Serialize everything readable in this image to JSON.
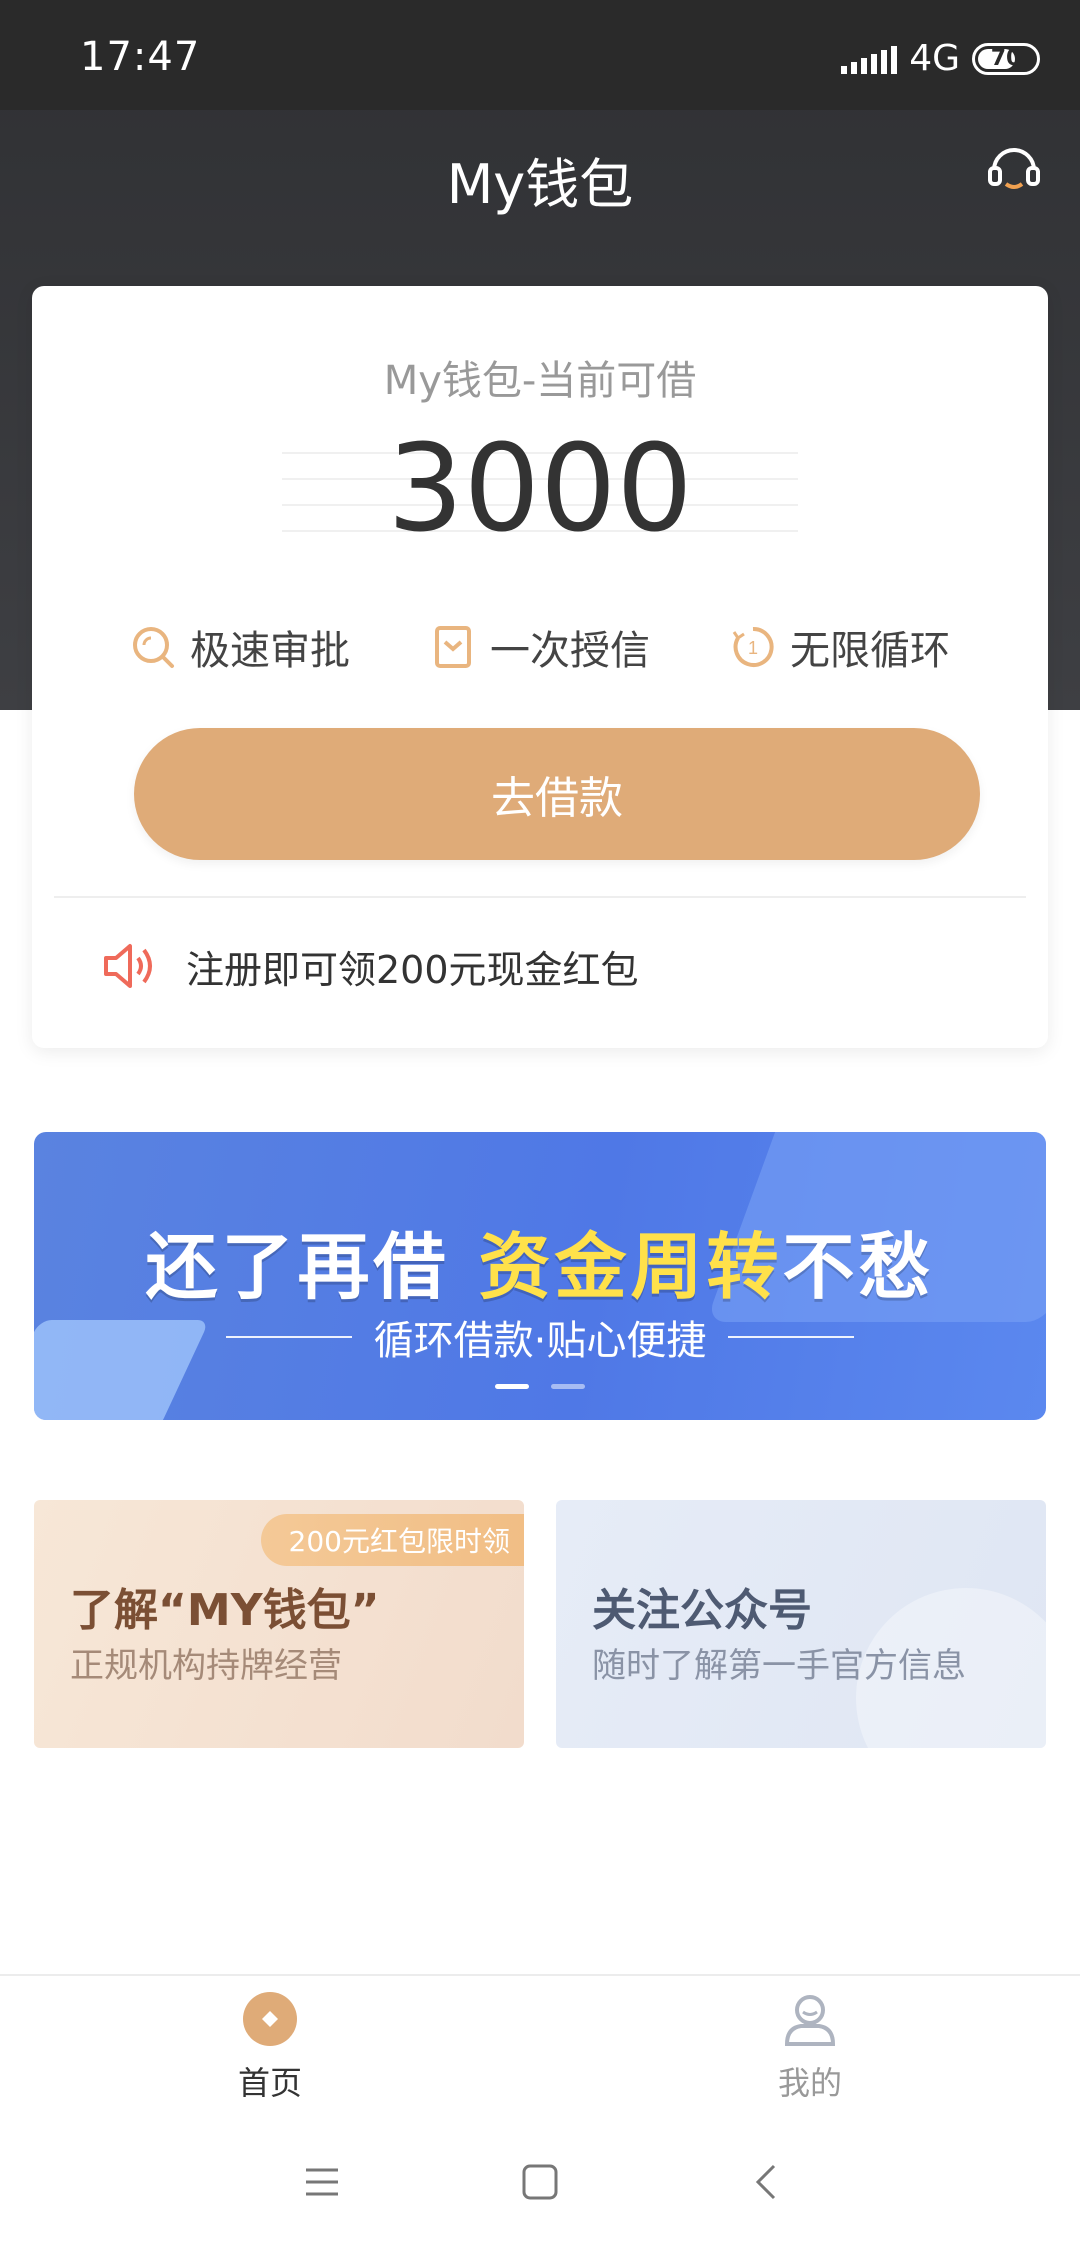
{
  "status_bar": {
    "time": "17:47",
    "network": "4G",
    "battery": "70",
    "battery_level": 0.7
  },
  "header": {
    "title": "My钱包",
    "service_icon": "headset-icon"
  },
  "card": {
    "subtitle": "My钱包-当前可借",
    "amount": "3000",
    "features": [
      {
        "label": "极速审批",
        "icon": "search-clock-icon"
      },
      {
        "label": "一次授信",
        "icon": "bookmark-icon"
      },
      {
        "label": "无限循环",
        "icon": "cycle-icon"
      }
    ],
    "borrow_button": "去借款",
    "promo": {
      "text": "注册即可领200元现金红包",
      "icon": "speaker-icon"
    }
  },
  "banner": {
    "title_part1": "还了再借",
    "title_highlight": "资金周转",
    "title_part2": "不愁",
    "subtitle": "循环借款·贴心便捷",
    "slides": 2,
    "active_slide": 1
  },
  "info_cards": [
    {
      "title": "了解“MY钱包”",
      "desc": "正规机构持牌经营",
      "ribbon": "200元红包限时领"
    },
    {
      "title": "关注公众号",
      "desc": "随时了解第一手官方信息"
    }
  ],
  "bottom_nav": [
    {
      "label": "首页",
      "icon": "home-coin-icon",
      "active": true
    },
    {
      "label": "我的",
      "icon": "user-icon",
      "active": false
    }
  ],
  "colors": {
    "accent": "#dfab78",
    "header_bg": "#2f3033",
    "banner_blue": "#4f78e6",
    "highlight_yellow": "#ffe14a"
  }
}
